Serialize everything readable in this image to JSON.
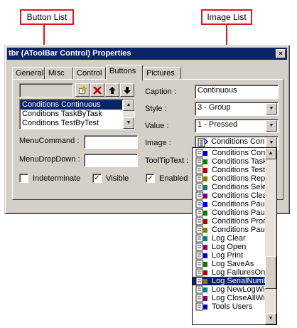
{
  "callouts": {
    "button_list": "Button List",
    "image_list": "Image List"
  },
  "window": {
    "title": "tbr (AToolBar Control) Properties",
    "close_glyph": "×"
  },
  "tabs": [
    {
      "label": "General"
    },
    {
      "label": "Misc"
    },
    {
      "label": "Control"
    },
    {
      "label": "Buttons"
    },
    {
      "label": "Pictures"
    }
  ],
  "button_list": {
    "items": [
      "Conditions Continuous",
      "Conditions TaskByTask",
      "Conditions TestByTest"
    ],
    "selected_index": 0
  },
  "fields": {
    "caption_label": "Caption :",
    "caption_value": "Continuous",
    "style_label": "Style :",
    "style_value": "3 - Group",
    "value_label": "Value :",
    "value_value": "1 - Pressed",
    "image_label": "Image :",
    "image_value": "Conditions Con",
    "tooltip_label": "ToolTipText :",
    "menu_command_label": "MenuCommand :",
    "menu_dropdown_label": "MenuDropDown :"
  },
  "checkboxes": {
    "indeterminate": {
      "label": "Indeterminate",
      "checked": false
    },
    "visible": {
      "label": "Visible",
      "checked": true
    },
    "enabled": {
      "label": "Enabled",
      "checked": true
    }
  },
  "image_dropdown": {
    "items": [
      "Conditions Cont",
      "Conditions Task",
      "Conditions TestI",
      "Conditions Repe",
      "Conditions Selec",
      "Conditions Clear",
      "Conditions Paus",
      "Conditions Paus",
      "Conditions Prom",
      "Conditions Paus",
      "Log Clear",
      "Log Open",
      "Log Print",
      "Log SaveAs",
      "Log FailuresOnl",
      "Log SerialNumb",
      "Log NewLogWi",
      "Log CloseAllWir",
      "Tools Users"
    ],
    "selected_index": 15
  },
  "colors": {
    "accent": "#e0141c",
    "title_bar": "#0a246a",
    "face": "#d4d0c8"
  }
}
